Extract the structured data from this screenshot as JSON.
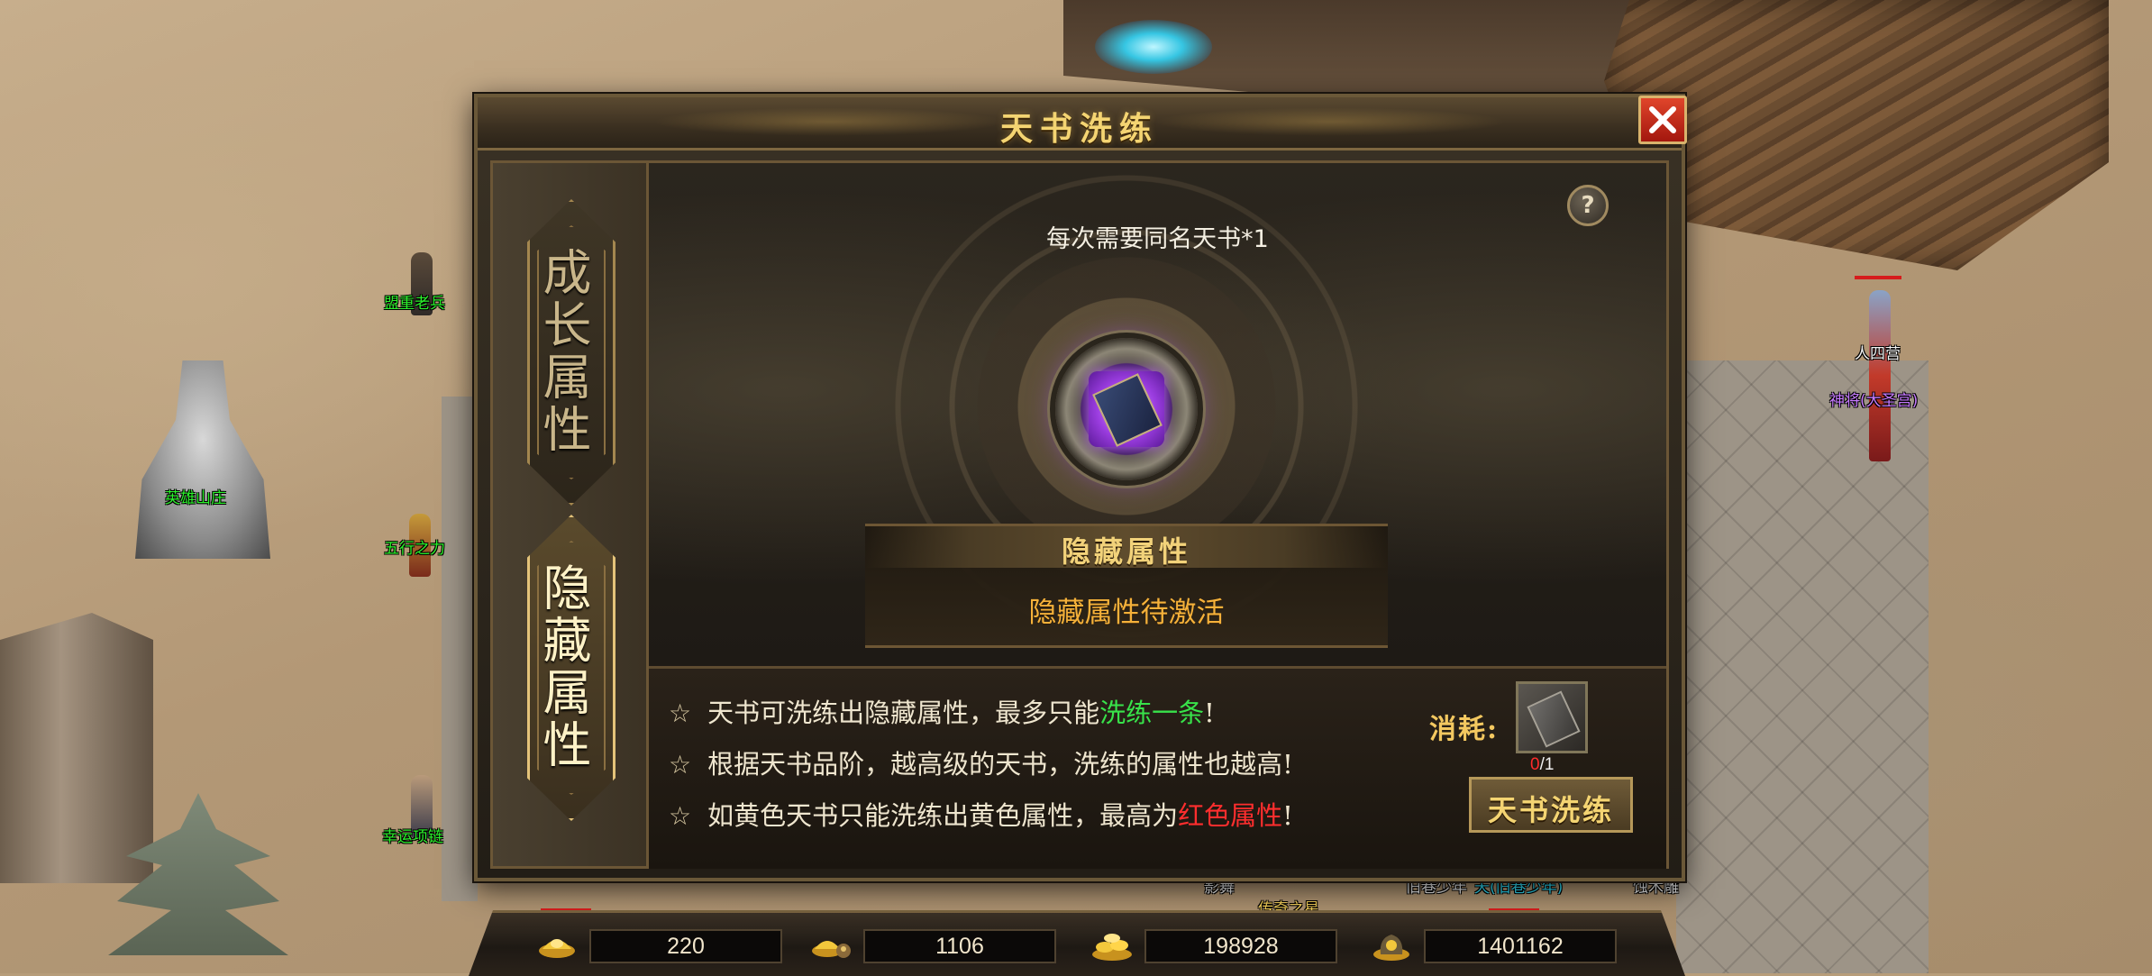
{
  "world": {
    "npcs": [
      {
        "name": "盟重老兵",
        "color": "green"
      },
      {
        "name": "英雄山庄",
        "color": "green"
      },
      {
        "name": "五行之力",
        "color": "green"
      },
      {
        "name": "幸运项链",
        "color": "green"
      },
      {
        "name": "人四营",
        "color": "white"
      },
      {
        "name": "神将(大圣宫)",
        "color": "purple"
      },
      {
        "name": "影舞",
        "color": "white"
      },
      {
        "name": "传奇之星",
        "color": "gold"
      },
      {
        "name": "旧巷少年",
        "color": "white"
      },
      {
        "name": "天(旧巷少年)",
        "color": "cyan"
      },
      {
        "name": "蚀木雕",
        "color": "white"
      }
    ]
  },
  "dialog": {
    "title": "天书洗练",
    "tabs": [
      {
        "label": "成长属性",
        "active": false
      },
      {
        "label": "隐藏属性",
        "active": true
      }
    ],
    "hint": "每次需要同名天书*1",
    "help_icon": "?",
    "attribute_title": "隐藏属性",
    "attribute_status": "隐藏属性待激活",
    "rules": [
      {
        "prefix": "天书可洗练出隐藏属性，最多只能",
        "highlight": "洗练一条",
        "suffix": "!",
        "highlight_color": "green"
      },
      {
        "prefix": "根据天书品阶，越高级的天书，洗练的属性也越高!",
        "highlight": "",
        "suffix": "",
        "highlight_color": ""
      },
      {
        "prefix": "如黄色天书只能洗练出黄色属性，最高为",
        "highlight": "红色属性",
        "suffix": "!",
        "highlight_color": "red"
      }
    ],
    "star": "☆",
    "cost_label": "消耗:",
    "cost_have": "0",
    "cost_need": "/1",
    "refine_button": "天书洗练"
  },
  "resources": [
    {
      "icon": "gold-ingot-icon",
      "value": "220"
    },
    {
      "icon": "ingot-bag-icon",
      "value": "1106"
    },
    {
      "icon": "gold-pile-icon",
      "value": "198928"
    },
    {
      "icon": "coin-bag-icon",
      "value": "1401162"
    }
  ],
  "colors": {
    "title_gold": "#f4d472",
    "status_orange": "#f5b13a",
    "highlight_green": "#38e24a",
    "highlight_red": "#ff2e2e",
    "close_red": "#c22a18"
  }
}
